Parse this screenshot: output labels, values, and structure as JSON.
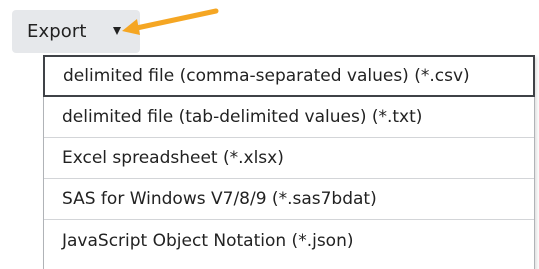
{
  "export_button": {
    "label": "Export",
    "caret": "caret-down-icon"
  },
  "pointer": {
    "icon": "orange-arrow-icon",
    "color": "#f5a623"
  },
  "menu": {
    "items": [
      {
        "label": "delimited file (comma-separated values) (*.csv)",
        "highlighted": true
      },
      {
        "label": "delimited file (tab-delimited values) (*.txt)"
      },
      {
        "label": "Excel spreadsheet (*.xlsx)"
      },
      {
        "label": "SAS for Windows V7/8/9 (*.sas7bdat)"
      },
      {
        "label": "JavaScript Object Notation (*.json)"
      }
    ]
  },
  "colors": {
    "button_bg": "#e6e8eb",
    "menu_border": "#b0b3b7",
    "highlight_border": "#3f4247",
    "arrow": "#f5a623"
  }
}
